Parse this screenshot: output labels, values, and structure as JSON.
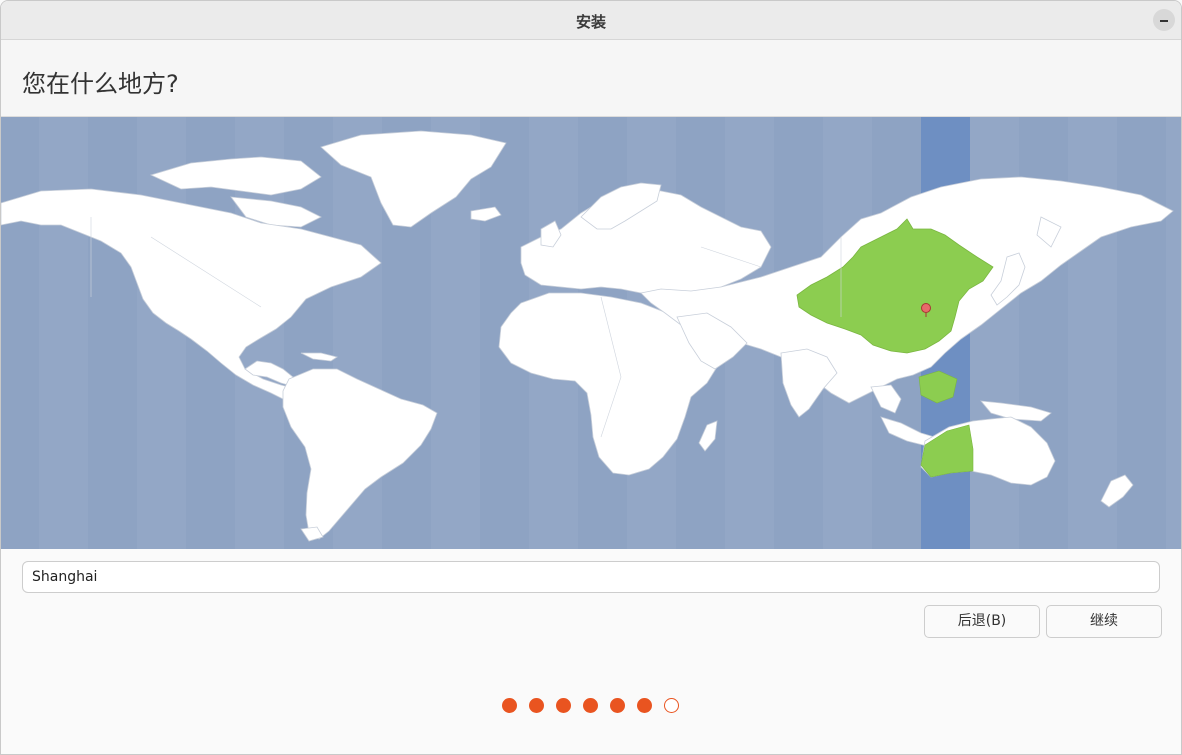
{
  "window": {
    "title": "安装"
  },
  "header": {
    "title": "您在什么地方?"
  },
  "location": {
    "value": "Shanghai"
  },
  "buttons": {
    "back": "后退(B)",
    "continue": "继续"
  },
  "progress": {
    "total_steps": 7,
    "completed_steps": 6,
    "current_step": 7
  },
  "map": {
    "selected_timezone": "Asia/Shanghai",
    "highlight_color": "#8ccd50",
    "ocean_color": "#93a7c6",
    "selected_band_color": "#6e8fc2"
  },
  "colors": {
    "accent": "#e95420",
    "land": "#ffffff"
  }
}
